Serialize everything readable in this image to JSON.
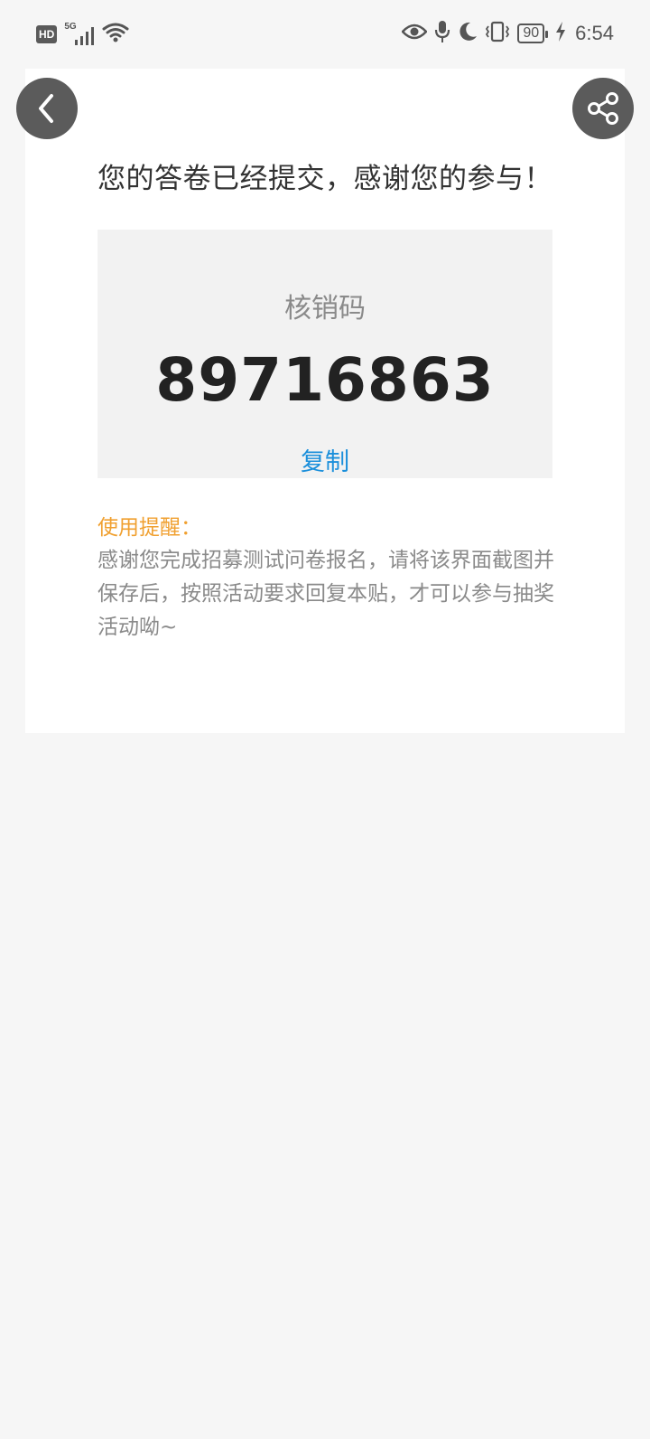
{
  "status_bar": {
    "hd": "HD",
    "network": "5G",
    "battery": "90",
    "time": "6:54",
    "icons": [
      "signal-icon",
      "wifi-icon",
      "eye-icon",
      "microphone-icon",
      "moon-icon",
      "vibrate-icon",
      "charging-icon"
    ]
  },
  "nav": {
    "back_icon": "chevron-left-icon",
    "share_icon": "share-icon"
  },
  "page": {
    "headline": "您的答卷已经提交，感谢您的参与！",
    "code_label": "核销码",
    "code_value": "89716863",
    "copy_label": "复制",
    "reminder_title": "使用提醒：",
    "reminder_body": "感谢您完成招募测试问卷报名，请将该界面截图并保存后，按照活动要求回复本贴，才可以参与抽奖活动呦~"
  },
  "colors": {
    "background": "#f6f6f6",
    "card": "#ffffff",
    "code_box": "#f2f2f2",
    "link": "#1a8fdb",
    "reminder_title": "#f0a030",
    "circle_button": "#5b5b5b"
  }
}
